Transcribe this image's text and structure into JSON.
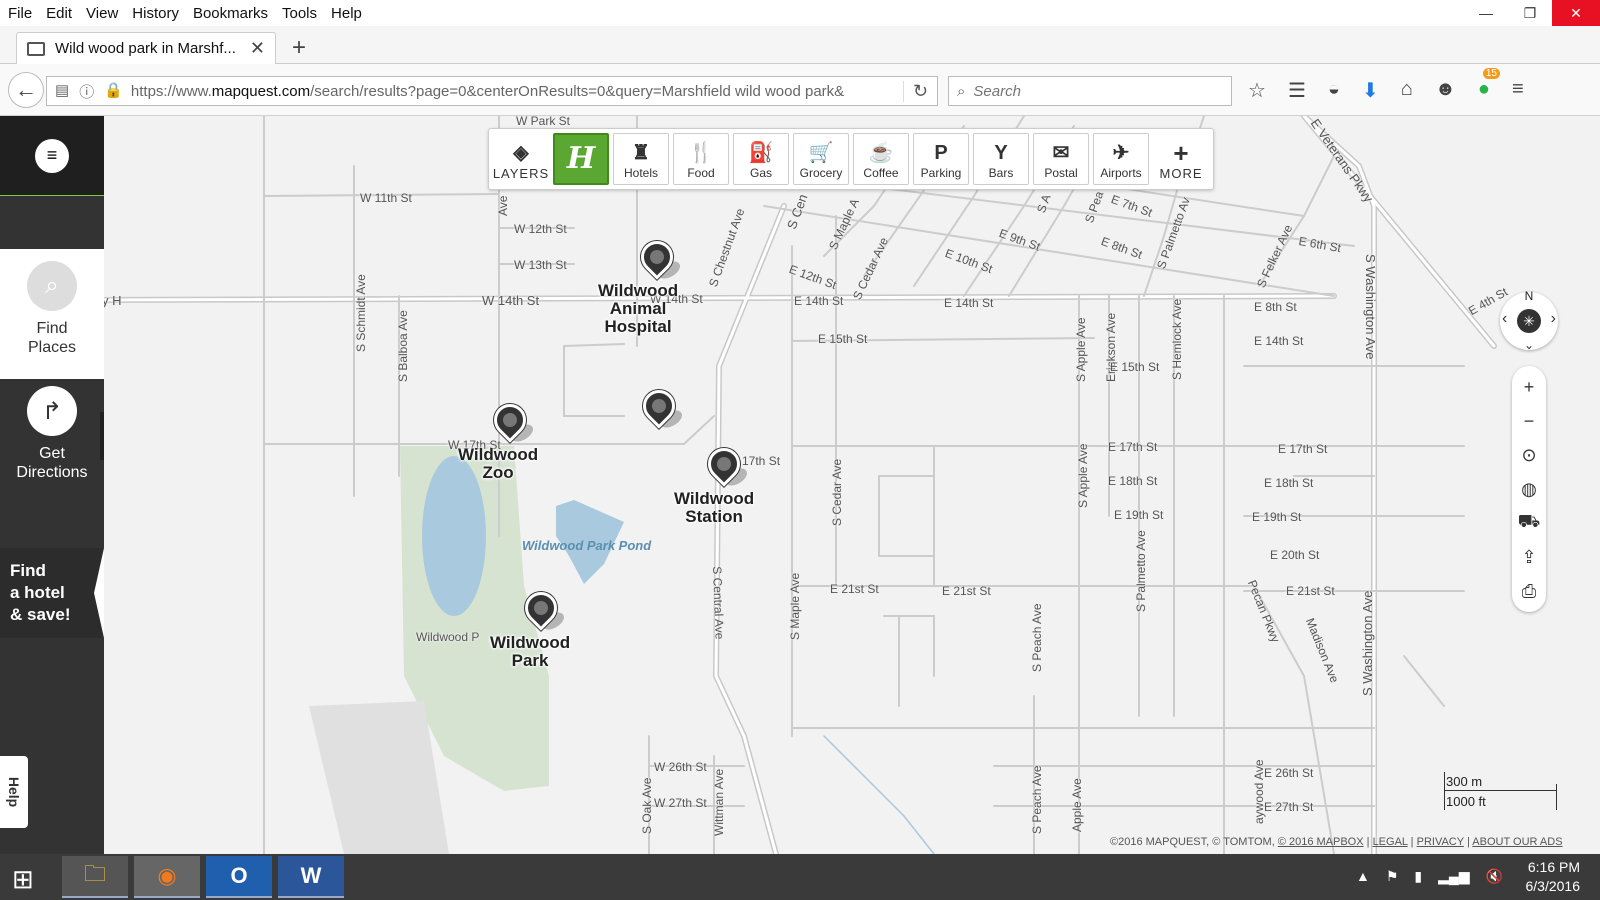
{
  "menubar": {
    "items": [
      "File",
      "Edit",
      "View",
      "History",
      "Bookmarks",
      "Tools",
      "Help"
    ]
  },
  "window_controls": {
    "minimize": "—",
    "restore": "❐",
    "close": "✕"
  },
  "tab": {
    "title": "Wild wood park in Marshf...",
    "close": "✕",
    "new_tab": "+"
  },
  "navbar": {
    "back": "←",
    "url_prefix": "https://www.",
    "url_domain": "mapquest.com",
    "url_rest": "/search/results?page=0&centerOnResults=0&query=Marshfield wild wood park&",
    "reload": "↻",
    "search_placeholder": "Search",
    "search_icon": "⌕",
    "toolbar_icons": [
      "☆",
      "☰",
      "◒",
      "⬇",
      "⌂",
      "☻",
      "15",
      "≡"
    ]
  },
  "sidebar": {
    "menu_icon": "≡",
    "find_places": {
      "icon": "⌕",
      "line1": "Find",
      "line2": "Places"
    },
    "get_directions": {
      "icon": "↱",
      "line1": "Get",
      "line2": "Directions"
    },
    "expand_icon": "›",
    "hotel_promo": {
      "line1": "Find",
      "line2": "a hotel",
      "line3": "& save!"
    },
    "help": "Help"
  },
  "poi_toolbar": [
    {
      "icon": "◈",
      "label": "LAYERS"
    },
    {
      "icon": "H",
      "label": ""
    },
    {
      "icon": "♜",
      "label": "Hotels"
    },
    {
      "icon": "🍴",
      "label": "Food"
    },
    {
      "icon": "⛽",
      "label": "Gas"
    },
    {
      "icon": "🛒",
      "label": "Grocery"
    },
    {
      "icon": "☕",
      "label": "Coffee"
    },
    {
      "icon": "P",
      "label": "Parking"
    },
    {
      "icon": "Y",
      "label": "Bars"
    },
    {
      "icon": "✉",
      "label": "Postal"
    },
    {
      "icon": "✈",
      "label": "Airports"
    },
    {
      "icon": "+",
      "label": "MORE"
    }
  ],
  "places": [
    {
      "line1": "Wildwood",
      "line2": "Animal",
      "line3": "Hospital"
    },
    {
      "line1": "Wildwood",
      "line2": "Zoo"
    },
    {
      "line1": "Wildwood",
      "line2": "Station"
    },
    {
      "line1": "Wildwood",
      "line2": "Park"
    }
  ],
  "streets": {
    "w_park": "W Park St",
    "w_11th": "W 11th St",
    "w_12th": "W 12th St",
    "w_13th": "W 13th St",
    "w_14th": "W 14th St",
    "w_14th_b": "W 14th St",
    "hwy": "y H",
    "w_17th": "W 17th St",
    "s_schmidt": "S Schmidt Ave",
    "s_balboa": "S Balboa Ave",
    "ave_top": "Ave",
    "s_central": "S Central Ave",
    "s_cen_top": "S Cen",
    "s_chestnut": "S Chestnut Ave",
    "s_maple_top": "S Maple A",
    "s_cedar_top": "S Cedar Ave",
    "e_12th": "E 12th St",
    "e_14th": "E 14th St",
    "e_14th_b": "E 14th St",
    "e_15th": "E 15th St",
    "e_10th": "E 10th St",
    "e_9th": "E 9th St",
    "e_8th": "E 8th St",
    "e_7th": "E 7th St",
    "s_palmetto_top": "S Palmetto Av",
    "s_pea": "S Pea",
    "s_a": "S A",
    "e_veterans": "E Veterans Pkwy",
    "e_6th": "E 6th St",
    "s_felker": "S Felker Ave",
    "e_4th": "E 4th St",
    "s_washington": "S Washington Ave",
    "e_8th_b": "E 8th St",
    "e_14th_c": "E 14th St",
    "s_apple": "S Apple Ave",
    "erickson": "Erickson Ave",
    "e_15th_b": "E 15th St",
    "s_hemlock": "S Hemlock Ave",
    "e_17th": "E 17th St",
    "e_17th_b": "E 17th St",
    "s_apple_b": "S Apple Ave",
    "e_18th": "E 18th St",
    "e_18th_b": "E 18th St",
    "e_19th": "E 19th St",
    "e_19th_b": "E 19th St",
    "s_cedar": "S Cedar Ave",
    "s_palmetto": "S Palmetto Ave",
    "e_20th": "E 20th St",
    "e_21st": "E 21st St",
    "e_21st_b": "E 21st St",
    "e_21st_c": "E 21st St",
    "pecan": "Pecan Pkwy",
    "madison": "Madison Ave",
    "s_washington_b": "S Washington Ave",
    "s_maple": "S Maple Ave",
    "s_peach": "S Peach Ave",
    "st_17th": "17th St",
    "w_26th": "W 26th St",
    "w_27th": "W 27th St",
    "s_oak": "S Oak Ave",
    "whitman": "Wittman Ave",
    "s_peach_b": "S Peach Ave",
    "apple_ave": "Apple Ave",
    "haywood": "aywood Ave",
    "e_26th": "E 26th St",
    "e_27th": "E 27th St",
    "wildwood_p": "Wildwood P"
  },
  "water_label": "Wildwood Park Pond",
  "map_controls": {
    "north": "N",
    "compass": "✳",
    "left": "‹",
    "right": "›",
    "down": "⌄",
    "zoom_in": "+",
    "zoom_out": "−",
    "locate": "⊙",
    "globe": "◍",
    "traffic": "⛟",
    "share": "⇪",
    "print": "⎙"
  },
  "scale": {
    "metric": "300 m",
    "imperial": "1000 ft"
  },
  "copyright": {
    "text": "©2016 MAPQUEST, © TOMTOM, ",
    "mapbox": "© 2016 MAPBOX",
    "legal": "LEGAL",
    "privacy": "PRIVACY",
    "ads": "ABOUT OUR ADS",
    "sep": " | "
  },
  "taskbar": {
    "start": "⊞",
    "apps": [
      "🗀",
      "◉",
      "O",
      "W"
    ],
    "tray": [
      "▲",
      "⚑",
      "▮",
      "▂▄▆",
      "🔇"
    ],
    "time": "6:16 PM",
    "date": "6/3/2016"
  },
  "colors": {
    "brand_green": "#5aa832",
    "map_bg": "#f2f2f2",
    "water": "#a9c9de",
    "park": "#d6e3d1",
    "accent": "#8bc43f"
  }
}
